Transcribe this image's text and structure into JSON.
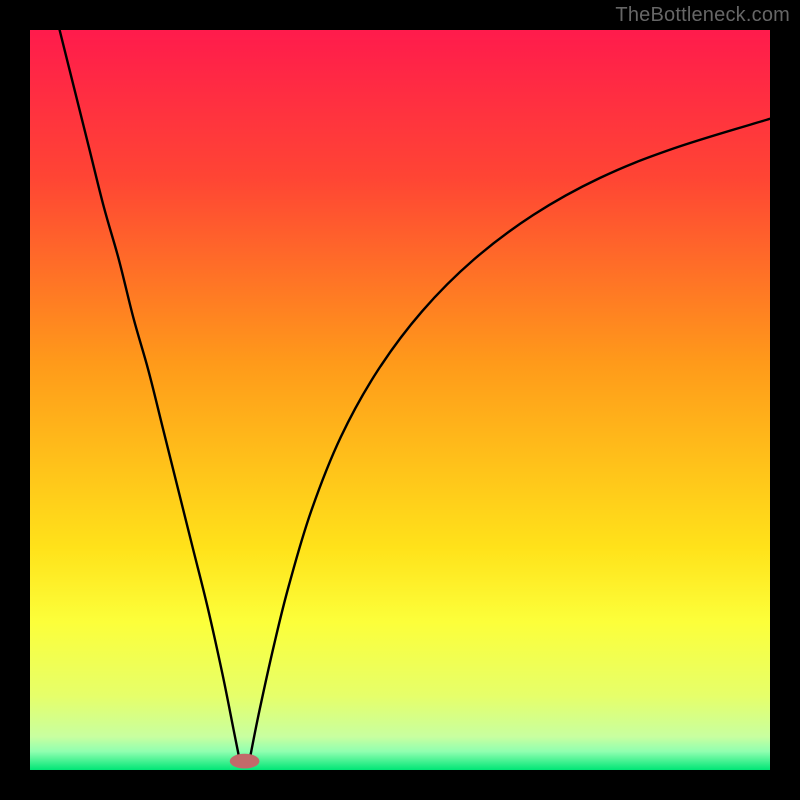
{
  "credit": "TheBottleneck.com",
  "chart_data": {
    "type": "line",
    "title": "",
    "xlabel": "",
    "ylabel": "",
    "xlim": [
      0,
      100
    ],
    "ylim": [
      0,
      100
    ],
    "background": {
      "type": "vertical_gradient",
      "stops": [
        {
          "pos": 0.0,
          "color": "#ff1b4c"
        },
        {
          "pos": 0.2,
          "color": "#ff4534"
        },
        {
          "pos": 0.45,
          "color": "#ff9a1a"
        },
        {
          "pos": 0.7,
          "color": "#ffe21a"
        },
        {
          "pos": 0.8,
          "color": "#fcff3a"
        },
        {
          "pos": 0.9,
          "color": "#e6ff6a"
        },
        {
          "pos": 0.955,
          "color": "#c8ffa0"
        },
        {
          "pos": 0.975,
          "color": "#90ffb0"
        },
        {
          "pos": 1.0,
          "color": "#00e676"
        }
      ]
    },
    "series": [
      {
        "name": "left-curve",
        "description": "steep descent from top-left to minimum",
        "x": [
          4,
          6,
          8,
          10,
          12,
          14,
          16,
          18,
          20,
          22,
          24,
          26,
          27.5,
          28.3
        ],
        "values": [
          100,
          92,
          84,
          76,
          69,
          61,
          54,
          46,
          38,
          30,
          22,
          13,
          5.5,
          1.5
        ]
      },
      {
        "name": "right-curve",
        "description": "asymptotic rise from minimum toward upper right",
        "x": [
          29.7,
          31,
          33,
          35,
          38,
          42,
          47,
          53,
          60,
          68,
          77,
          87,
          100
        ],
        "values": [
          1.5,
          8,
          17,
          25,
          35,
          45,
          54,
          62,
          69,
          75,
          80,
          84,
          88
        ]
      }
    ],
    "marker": {
      "name": "min-marker",
      "x": 29,
      "y": 1.2,
      "color": "#c16a6a",
      "rx": 2.0,
      "ry": 1.0
    }
  }
}
